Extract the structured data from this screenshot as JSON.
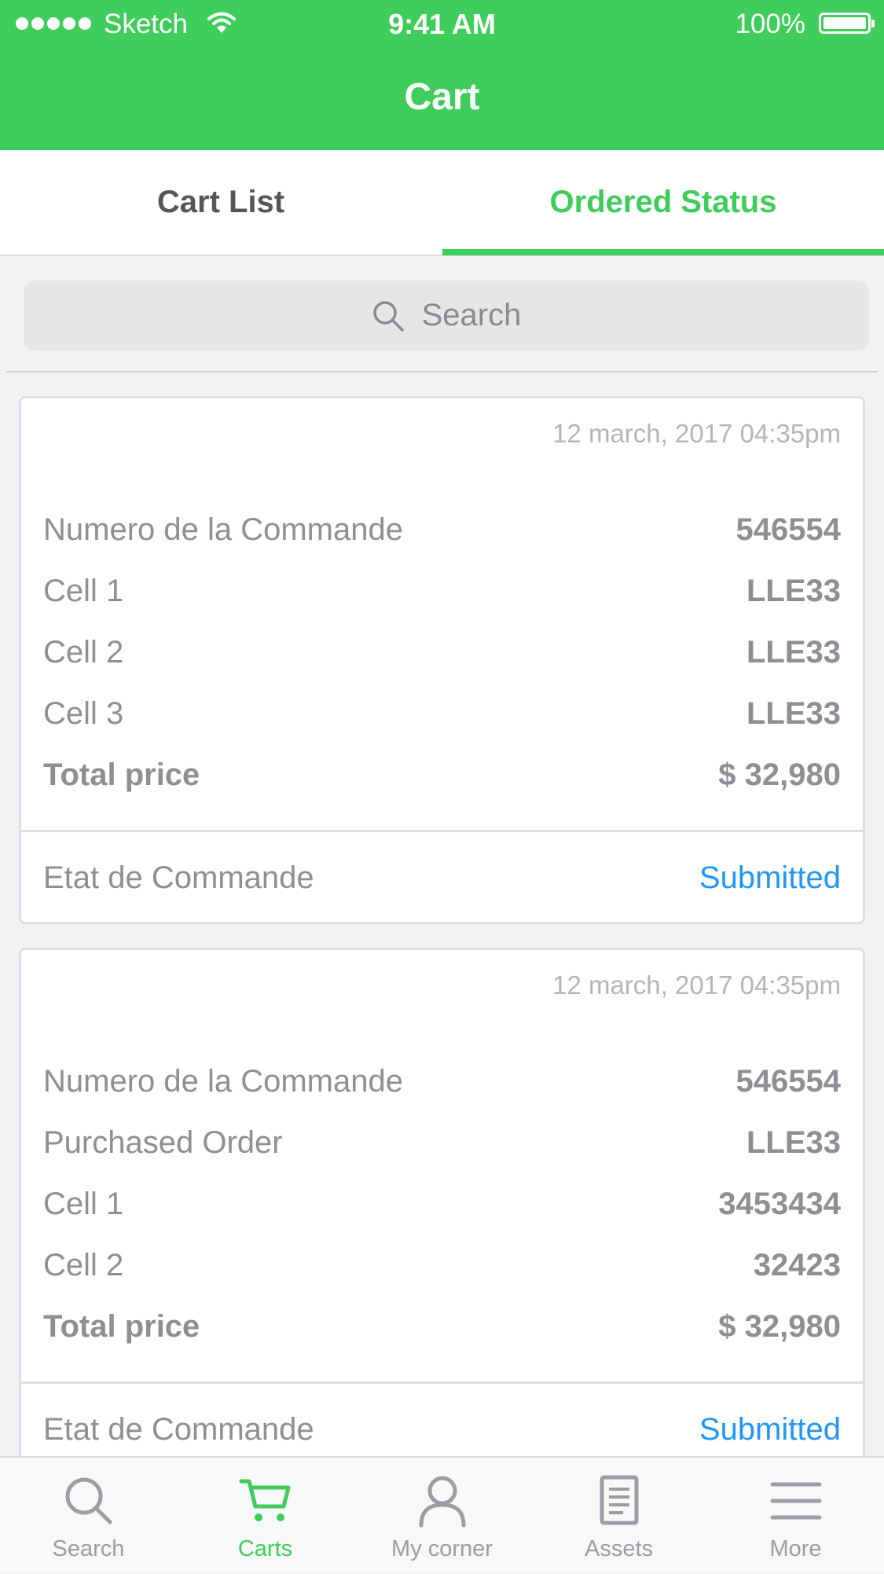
{
  "status_bar": {
    "carrier": "Sketch",
    "time": "9:41 AM",
    "battery": "100%"
  },
  "header": {
    "title": "Cart"
  },
  "tabs": [
    {
      "label": "Cart List",
      "active": false
    },
    {
      "label": "Ordered Status",
      "active": true
    }
  ],
  "search": {
    "placeholder": "Search"
  },
  "orders": [
    {
      "date": "12 march, 2017  04:35pm",
      "rows": [
        {
          "label": "Numero de la Commande",
          "value": "546554"
        },
        {
          "label": "Cell 1",
          "value": "LLE33"
        },
        {
          "label": "Cell 2",
          "value": "LLE33"
        },
        {
          "label": "Cell 3",
          "value": "LLE33"
        },
        {
          "label": "Total price",
          "value": "$ 32,980"
        }
      ],
      "footer": {
        "label": "Etat de Commande",
        "status": "Submitted"
      }
    },
    {
      "date": "12 march, 2017  04:35pm",
      "rows": [
        {
          "label": "Numero de la Commande",
          "value": "546554"
        },
        {
          "label": "Purchased Order",
          "value": "LLE33"
        },
        {
          "label": "Cell 1",
          "value": "3453434"
        },
        {
          "label": "Cell 2",
          "value": "32423"
        },
        {
          "label": "Total price",
          "value": "$ 32,980"
        }
      ],
      "footer": {
        "label": "Etat de Commande",
        "status": "Submitted"
      }
    }
  ],
  "tab_bar": [
    {
      "label": "Search",
      "icon": "search-icon",
      "active": false
    },
    {
      "label": "Carts",
      "icon": "cart-icon",
      "active": true
    },
    {
      "label": "My corner",
      "icon": "user-icon",
      "active": false
    },
    {
      "label": "Assets",
      "icon": "document-icon",
      "active": false
    },
    {
      "label": "More",
      "icon": "menu-icon",
      "active": false
    }
  ],
  "colors": {
    "brand_green": "#3ecd5b",
    "status_blue": "#2196f3",
    "text_gray": "#8e8e93"
  }
}
